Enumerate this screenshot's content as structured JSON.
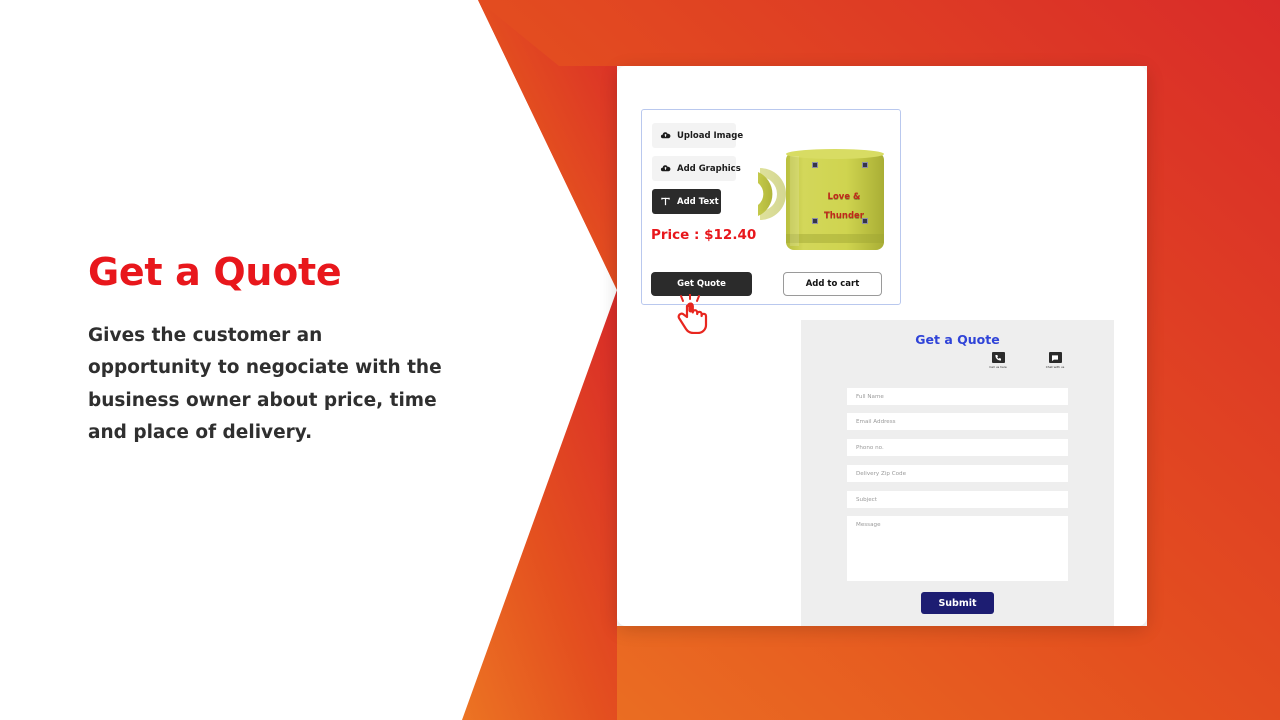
{
  "background": {
    "gradient_start": "#ec7423",
    "gradient_end": "#d92b29",
    "page_bg": "#ffffff"
  },
  "left_panel": {
    "headline": "Get a Quote",
    "headline_color": "#e8171c",
    "body": "Gives the customer an opportunity to negociate with the business owner about price, time and place of delivery."
  },
  "customizer": {
    "tools": [
      {
        "label": "Upload Image",
        "icon": "cloud-upload-icon",
        "active": false
      },
      {
        "label": "Add Graphics",
        "icon": "cloud-upload-icon",
        "active": false
      },
      {
        "label": "Add Text",
        "icon": "text-tool-icon",
        "active": true
      }
    ],
    "price_label": "Price : $12.40",
    "price_color": "#e8171c",
    "primary_button": "Get Quote",
    "secondary_button": "Add to cart",
    "product": {
      "type": "mug",
      "body_color": "#ccd047",
      "text_line_1": "Love &",
      "text_line_2": "Thunder",
      "text_color": "#c0281b",
      "selection_handles": 4
    }
  },
  "quote_form": {
    "title": "Get a Quote",
    "title_color": "#2f43d8",
    "contact_options": [
      {
        "label": "Call us here",
        "icon": "phone-icon"
      },
      {
        "label": "Chat with us",
        "icon": "chat-bubble-icon"
      }
    ],
    "fields": [
      {
        "placeholder": "Full Name",
        "value": "",
        "type": "text"
      },
      {
        "placeholder": "Email Address",
        "value": "",
        "type": "email"
      },
      {
        "placeholder": "Phono no.",
        "value": "",
        "type": "tel"
      },
      {
        "placeholder": "Delivery Zip Code",
        "value": "",
        "type": "text"
      },
      {
        "placeholder": "Subject",
        "value": "",
        "type": "text"
      },
      {
        "placeholder": "Message",
        "value": "",
        "type": "textarea"
      }
    ],
    "submit_label": "Submit",
    "submit_color": "#1d1d72"
  },
  "cursor": {
    "type": "pointing-hand-click",
    "color": "#e8261f"
  }
}
